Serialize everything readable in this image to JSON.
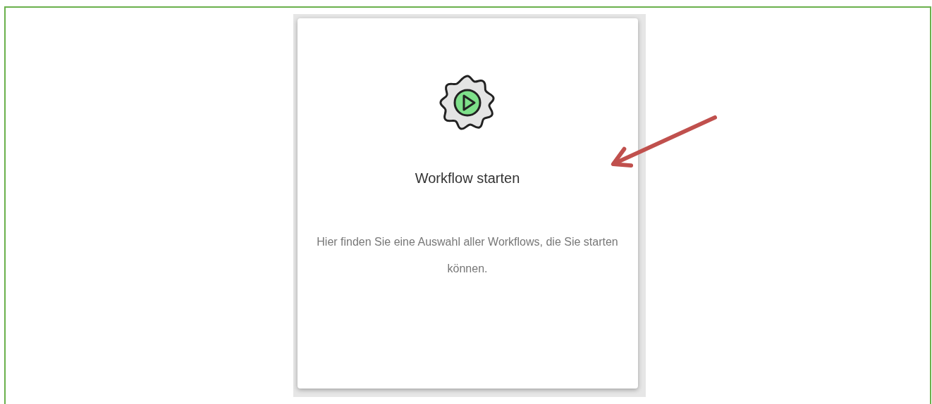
{
  "card": {
    "title": "Workflow starten",
    "description": "Hier finden Sie eine Auswahl aller Workflows, die Sie starten können."
  }
}
